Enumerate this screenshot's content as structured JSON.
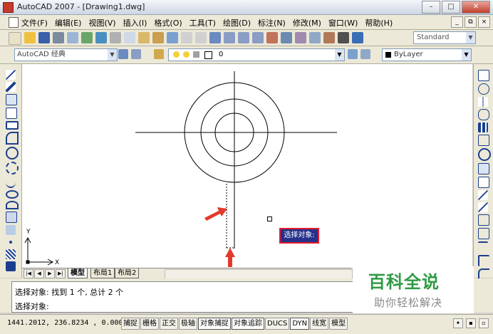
{
  "window": {
    "title": "AutoCAD 2007 - [Drawing1.dwg]",
    "minimize": "–",
    "restore": "□",
    "close": "✕"
  },
  "menu": {
    "items": [
      "文件(F)",
      "编辑(E)",
      "视图(V)",
      "插入(I)",
      "格式(O)",
      "工具(T)",
      "绘图(D)",
      "标注(N)",
      "修改(M)",
      "窗口(W)",
      "帮助(H)"
    ],
    "mdi_min": "_",
    "mdi_restore": "⧉",
    "mdi_close": "×"
  },
  "toolbar": {
    "text_style": "Standard",
    "workspace": "AutoCAD 经典",
    "layer_name": "0",
    "color": "ByLayer"
  },
  "canvas": {
    "tooltip": "选择对象:",
    "ucs_x": "X",
    "ucs_y": "Y"
  },
  "tabs": {
    "model": "模型",
    "layout1": "布局1",
    "layout2": "布局2"
  },
  "command": {
    "line1": "选择对象: 找到 1 个, 总计 2 个",
    "line2": "选择对象:"
  },
  "watermark": {
    "title": "百科全说",
    "subtitle": "助你轻松解决"
  },
  "status": {
    "coords": "1441.2012, 236.8234 , 0.0000",
    "buttons": [
      "捕捉",
      "栅格",
      "正交",
      "极轴",
      "对象捕捉",
      "对象追踪",
      "DUCS",
      "DYN",
      "线宽",
      "模型"
    ]
  }
}
